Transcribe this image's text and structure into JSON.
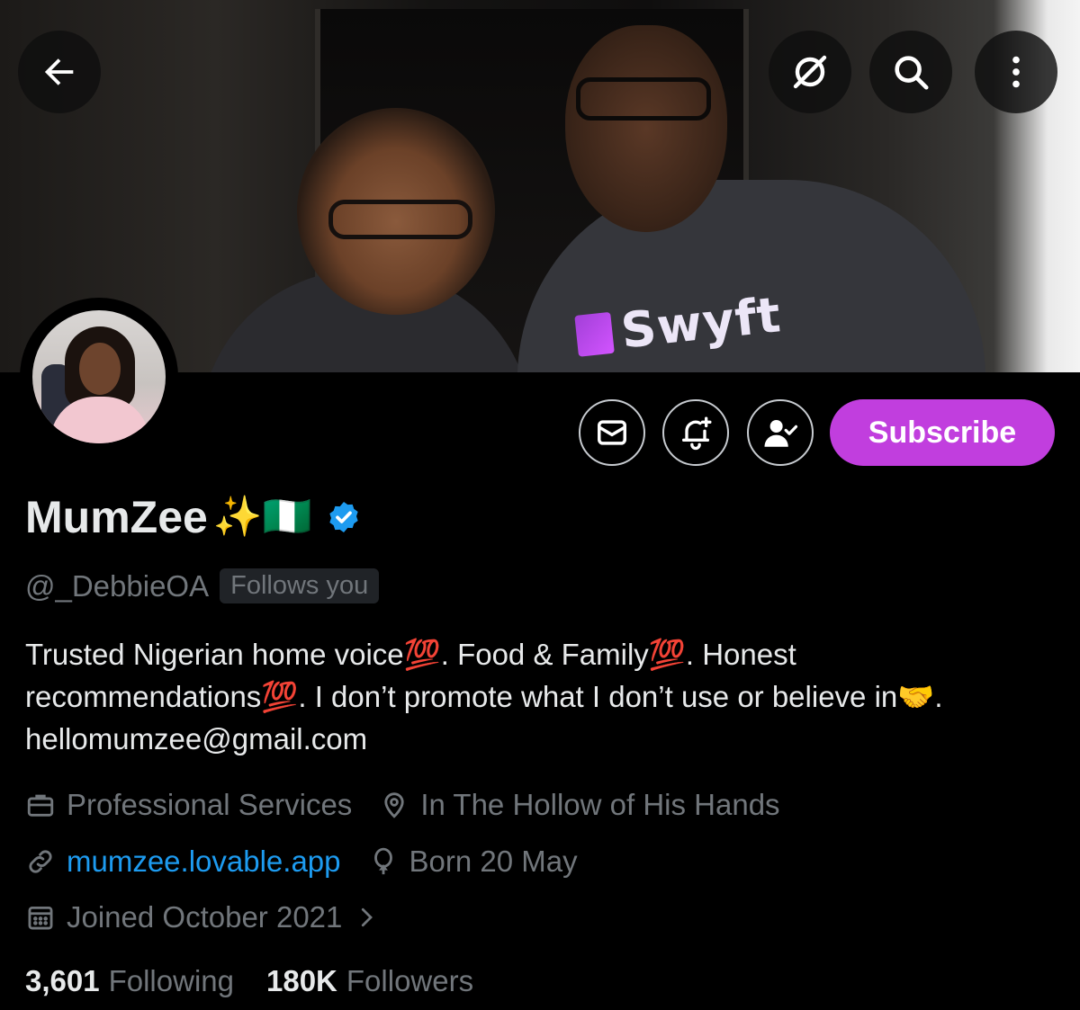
{
  "header": {
    "back_icon": "arrow-left-icon",
    "grok_icon": "grok-icon",
    "search_icon": "search-icon",
    "more_icon": "more-vertical-icon"
  },
  "banner": {
    "brand_text": "Swyft"
  },
  "actions": {
    "message_icon": "envelope-icon",
    "notify_icon": "bell-plus-icon",
    "following_icon": "user-check-icon",
    "subscribe_label": "Subscribe",
    "subscribe_color": "#c13ede"
  },
  "profile": {
    "display_name": "MumZee",
    "name_emoji": "✨🇳🇬",
    "verified": true,
    "verified_color": "#1d9bf0",
    "handle": "@_DebbieOA",
    "follows_you": "Follows you",
    "bio": "Trusted Nigerian home voice💯. Food & Family💯. Honest recommendations💯. I don’t promote what I don’t use or believe in🤝. hellomumzee@gmail.com"
  },
  "meta": {
    "category": "Professional Services",
    "location": "In The Hollow of His Hands",
    "website": "mumzee.lovable.app",
    "birthday": "Born 20 May",
    "joined": "Joined October 2021"
  },
  "stats": {
    "following_count": "3,601",
    "following_label": "Following",
    "followers_count": "180K",
    "followers_label": "Followers"
  },
  "colors": {
    "background": "#000000",
    "primary_text": "#e7e9ea",
    "secondary_text": "#71767b",
    "link": "#1d9bf0"
  }
}
